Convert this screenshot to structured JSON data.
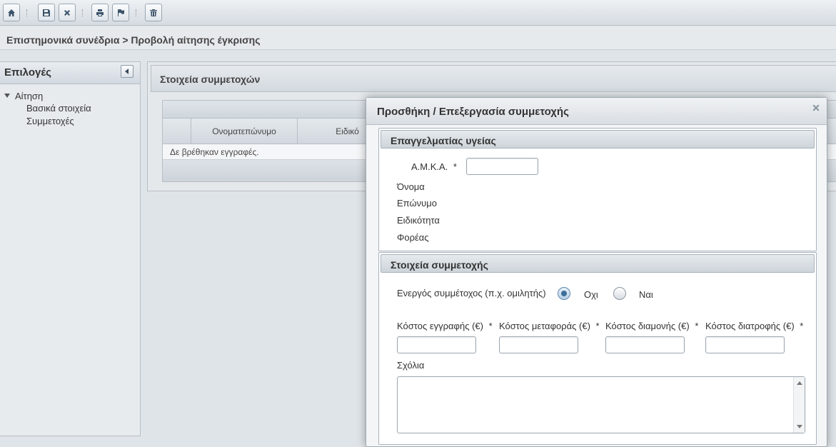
{
  "toolbar": {
    "buttons": [
      {
        "icon": "home-icon"
      },
      {
        "icon": "save-icon"
      },
      {
        "icon": "close-icon"
      },
      {
        "icon": "print-icon"
      },
      {
        "icon": "flag-icon"
      },
      {
        "icon": "trash-icon"
      }
    ]
  },
  "breadcrumb": "Επιστημονικά συνέδρια > Προβολή αίτησης έγκρισης",
  "sidebar": {
    "title": "Επιλογές",
    "tree": {
      "root": "Αίτηση",
      "children": [
        "Βασικά στοιχεία",
        "Συμμετοχές"
      ]
    }
  },
  "main": {
    "title": "Στοιχεία συμμετοχών",
    "grid": {
      "columns": [
        "",
        "Ονοματεπώνυμο",
        "Ειδικό"
      ],
      "empty_text": "Δε βρέθηκαν εγγραφές."
    }
  },
  "dialog": {
    "title": "Προσθήκη / Επεξεργασία συμμετοχής",
    "section1": {
      "title": "Επαγγελματίας υγείας",
      "amka_label": "Α.Μ.Κ.Α.",
      "amka_value": "",
      "required_mark": "*",
      "name_label": "Όνομα",
      "surname_label": "Επώνυμο",
      "specialty_label": "Ειδικότητα",
      "organization_label": "Φορέας"
    },
    "section2": {
      "title": "Στοιχεία συμμετοχής",
      "active_label": "Ενεργός συμμέτοχος (π.χ. ομιλητής)",
      "option_no": "Οχι",
      "option_yes": "Ναι",
      "selected": "no",
      "costs": [
        {
          "label": "Κόστος εγγραφής (€)",
          "value": ""
        },
        {
          "label": "Κόστος μεταφοράς (€)",
          "value": ""
        },
        {
          "label": "Κόστος διαμονής (€)",
          "value": ""
        },
        {
          "label": "Κόστος διατροφής (€)",
          "value": ""
        }
      ],
      "comments_label": "Σχόλια",
      "comments_value": ""
    }
  }
}
